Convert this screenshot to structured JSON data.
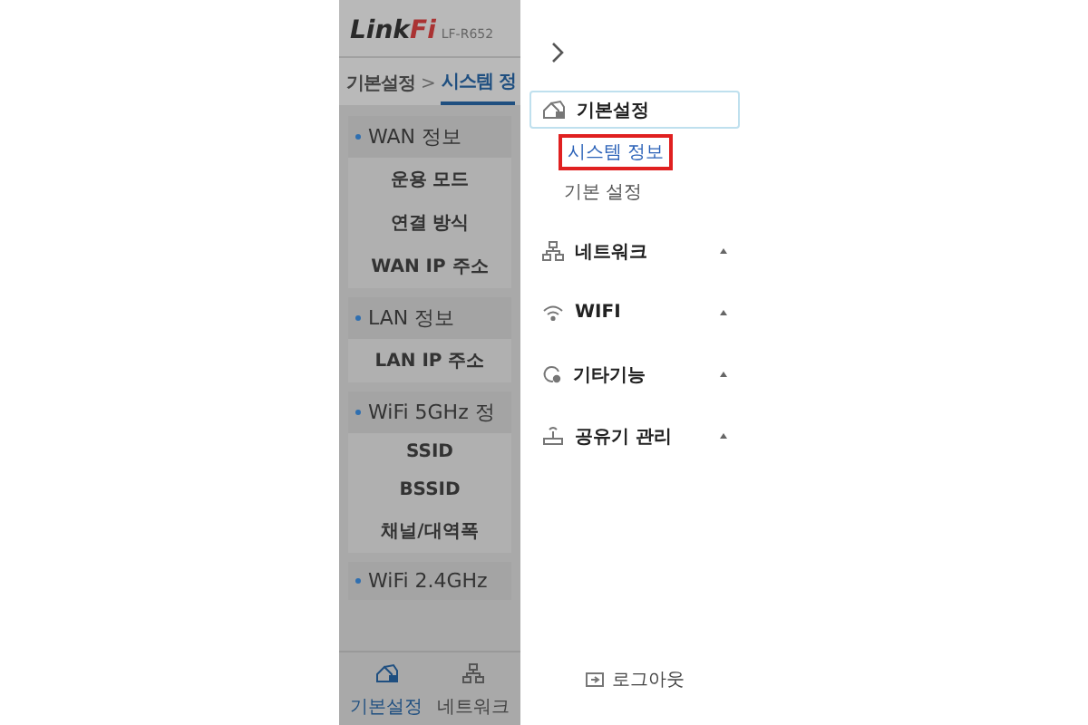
{
  "brand": {
    "logo_main": "Link",
    "logo_accent": "Fi",
    "model": "LF-R652"
  },
  "breadcrumb": {
    "items": [
      {
        "label": "기본설정",
        "selected": false
      },
      {
        "label": "시스템 정",
        "selected": true
      }
    ],
    "separator": ">"
  },
  "sections": [
    {
      "title": "WAN 정보",
      "rows": [
        "운용 모드",
        "연결 방식",
        "WAN IP 주소"
      ]
    },
    {
      "title": "LAN 정보",
      "rows": [
        "LAN IP 주소"
      ]
    },
    {
      "title": "WiFi 5GHz 정",
      "rows": [
        "SSID",
        "BSSID",
        "채널/대역폭"
      ]
    },
    {
      "title": "WiFi 2.4GHz"
    }
  ],
  "bottom_nav": [
    {
      "label": "기본설정",
      "selected": true
    },
    {
      "label": "네트워크",
      "selected": false
    }
  ],
  "drawer": {
    "menu": [
      {
        "label": "기본설정",
        "selected": true,
        "expanded": true,
        "children": [
          {
            "label": "시스템 정보",
            "selected": true
          },
          {
            "label": "기본 설정",
            "selected": false
          }
        ]
      },
      {
        "label": "네트워크",
        "selected": false,
        "expanded": false
      },
      {
        "label": "WIFI",
        "selected": false,
        "expanded": false
      },
      {
        "label": "기타기능",
        "selected": false,
        "expanded": false
      },
      {
        "label": "공유기 관리",
        "selected": false,
        "expanded": false
      }
    ],
    "logout": "로그아웃"
  }
}
